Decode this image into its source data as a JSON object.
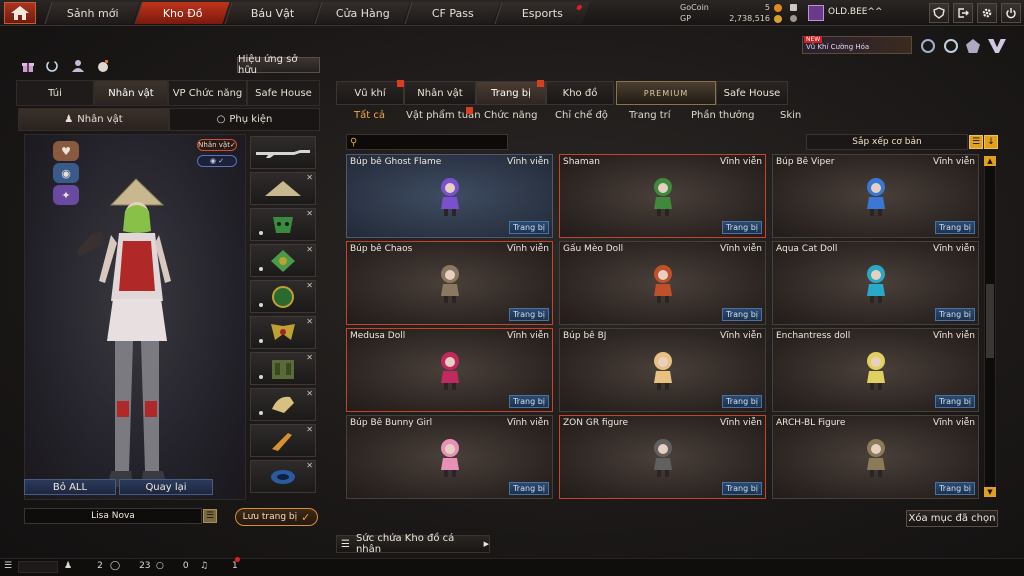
{
  "nav": {
    "tabs": [
      "Sảnh mới",
      "Kho Đồ",
      "Báu Vật",
      "Cửa Hàng",
      "CF Pass",
      "Esports"
    ],
    "active": "Kho Đồ"
  },
  "wallet": {
    "gocoin_label": "GoCoin",
    "gocoin_value": "5",
    "gp_label": "GP",
    "gp_value": "2,738,516"
  },
  "user": {
    "name": "OLD.BEE^^"
  },
  "promo": {
    "badge": "NEW",
    "text": "Vũ Khí Cường Hóa"
  },
  "left": {
    "owned_effect_button": "Hiệu ứng sở hữu",
    "tabs": [
      "Túi",
      "Nhân vật",
      "VP Chức năng",
      "Safe House"
    ],
    "subtabs": [
      "Nhân vật",
      "Phụ kiện"
    ],
    "char_badge": "Nhân vật",
    "char_badge2": "",
    "remove_all": "Bỏ ALL",
    "back": "Quay lại",
    "character_name": "Lisa Nova",
    "save_label": "Lưu trang bị"
  },
  "right": {
    "tabs": [
      "Vũ khí",
      "Nhân vật",
      "Trang bị",
      "Kho đồ",
      "PREMIUM",
      "Safe House"
    ],
    "categories": [
      "Tất cả",
      "Vật phẩm tuần",
      "Chức năng",
      "Chỉ chế độ",
      "Trang trí",
      "Phần thưởng",
      "Skin"
    ],
    "sort_label": "Sắp xếp cơ bản",
    "equip_label": "Trang bị",
    "clear_label": "Xóa mục đã chọn",
    "capacity_label": "Sức chứa Kho đồ cá nhân",
    "items": [
      {
        "name": "Búp bê Ghost Flame",
        "duration": "Vĩnh viễn",
        "fig": "purple-doll-icon",
        "color": "#7a4fd0",
        "state": "highlight"
      },
      {
        "name": "Shaman",
        "duration": "Vĩnh viễn",
        "fig": "tribal-mask-icon",
        "color": "#3f8a3a",
        "state": "selected"
      },
      {
        "name": "Búp Bê Viper",
        "duration": "Vĩnh viễn",
        "fig": "blue-doll-icon",
        "color": "#3a78d8",
        "state": "normal"
      },
      {
        "name": "Búp bê Chaos",
        "duration": "Vĩnh viễn",
        "fig": "chaos-doll-icon",
        "color": "#8a7860",
        "state": "selected"
      },
      {
        "name": "Gấu Mèo Doll",
        "duration": "Vĩnh viễn",
        "fig": "red-panda-icon",
        "color": "#c0502a",
        "state": "normal"
      },
      {
        "name": "Aqua Cat Doll",
        "duration": "Vĩnh viễn",
        "fig": "aqua-cat-icon",
        "color": "#2aa8c8",
        "state": "normal"
      },
      {
        "name": "Medusa Doll",
        "duration": "Vĩnh viễn",
        "fig": "medusa-doll-icon",
        "color": "#c02a60",
        "state": "selected"
      },
      {
        "name": "Búp bê BJ",
        "duration": "Vĩnh viễn",
        "fig": "bj-doll-icon",
        "color": "#e8c080",
        "state": "normal"
      },
      {
        "name": "Enchantress doll",
        "duration": "Vĩnh viễn",
        "fig": "enchantress-doll-icon",
        "color": "#e0d060",
        "state": "normal"
      },
      {
        "name": "Búp Bê Bunny Girl",
        "duration": "Vĩnh viễn",
        "fig": "bunny-doll-icon",
        "color": "#e890b8",
        "state": "normal"
      },
      {
        "name": "ZON GR figure",
        "duration": "Vĩnh viễn",
        "fig": "soldier-figure-icon",
        "color": "#606060",
        "state": "selected"
      },
      {
        "name": "ARCH-BL Figure",
        "duration": "Vĩnh viễn",
        "fig": "soldier-figure-2-icon",
        "color": "#8a7a5a",
        "state": "normal"
      }
    ]
  },
  "bottom": {
    "friends": "2",
    "clan": "23",
    "chat": "0",
    "alerts": "1"
  },
  "colors": {
    "accent": "#c0341c",
    "equip_blue": "#2c4a70",
    "selected_border": "#c4462a",
    "gold": "#e0a020"
  }
}
